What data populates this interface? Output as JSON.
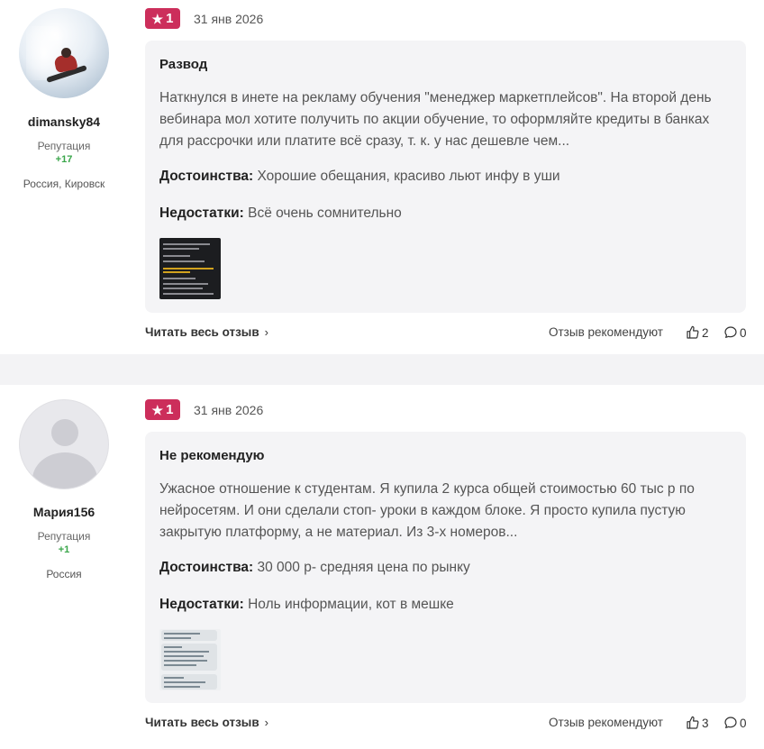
{
  "reviews": [
    {
      "author": {
        "username": "dimansky84",
        "reputation_label": "Репутация",
        "reputation_value": "+17",
        "location": "Россия, Кировск",
        "avatar": "snowboarder-photo"
      },
      "rating": "1",
      "date": "31 янв 2026",
      "title": "Развод",
      "text": "Наткнулся в инете на рекламу обучения \"менеджер маркетплейсов\". На второй день вебинара мол хотите получить по акции обучение, то оформляйте кредиты в банках для рассрочки или платите всё сразу, т. к. у нас дешевле чем...",
      "pros_label": "Достоинства:",
      "pros": "Хорошие обещания, красиво льют инфу в уши",
      "cons_label": "Недостатки:",
      "cons": "Всё очень сомнительно",
      "read_more": "Читать весь отзыв",
      "recommend_label": "Отзыв рекомендуют",
      "likes": "2",
      "comments": "0"
    },
    {
      "author": {
        "username": "Мария156",
        "reputation_label": "Репутация",
        "reputation_value": "+1",
        "location": "Россия",
        "avatar": "default-avatar"
      },
      "rating": "1",
      "date": "31 янв 2026",
      "title": "Не рекомендую",
      "text": "Ужасное отношение к студентам. Я купила 2 курса общей стоимостью 60 тыс р по нейросетям. И они сделали стоп- уроки в каждом блоке. Я просто купила пустую закрытую платформу, а не материал. Из 3-х номеров...",
      "pros_label": "Достоинства:",
      "pros": "30 000 р- средняя цена по рынку",
      "cons_label": "Недостатки:",
      "cons": "Ноль информации, кот в мешке",
      "read_more": "Читать весь отзыв",
      "recommend_label": "Отзыв рекомендуют",
      "likes": "3",
      "comments": "0"
    }
  ],
  "colors": {
    "badge": "#cc2e5b",
    "reputation": "#3aa64a",
    "card_bg": "#f4f4f6",
    "separator": "#f3f3f5"
  }
}
